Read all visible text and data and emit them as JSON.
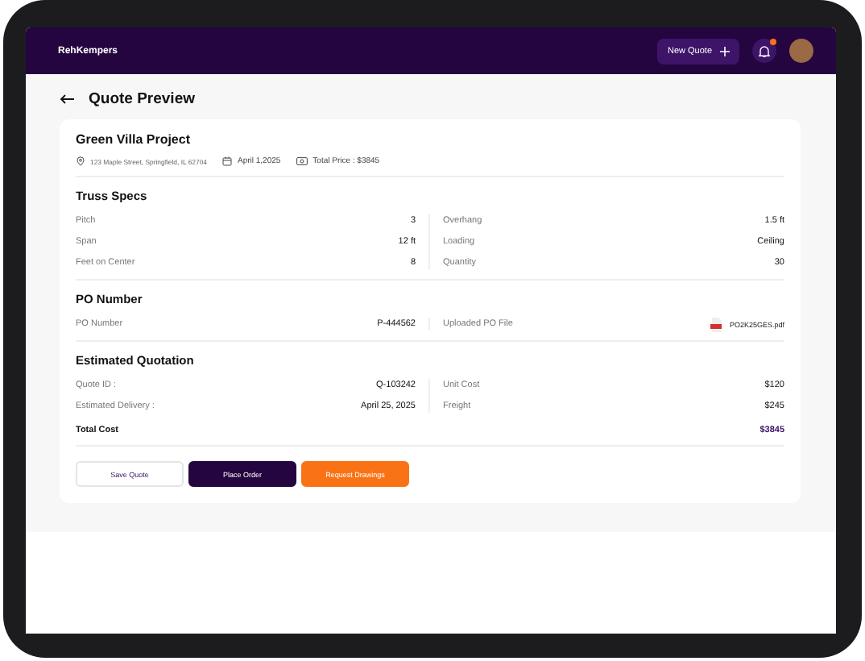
{
  "header": {
    "brand": "RehKempers",
    "new_quote_button": "New Quote",
    "has_notification": true
  },
  "page_title": "Quote Preview",
  "project": {
    "name": "Green Villa Project",
    "address": "123 Maple Street, Springfield, IL 62704",
    "date": "April 1,2025",
    "total_price": "Total Price : $3845"
  },
  "sections": [
    {
      "title": "Truss Specs",
      "left": [
        {
          "label": "Pitch",
          "value": "3",
          "kind": "text"
        },
        {
          "label": "Span",
          "value": "12 ft",
          "kind": "text"
        },
        {
          "label": "Feet on Center",
          "value": "8",
          "kind": "text"
        }
      ],
      "right": [
        {
          "label": "Overhang",
          "value": "1.5 ft",
          "kind": "text"
        },
        {
          "label": "Loading",
          "value": "Ceiling",
          "kind": "text"
        },
        {
          "label": "Quantity",
          "value": "30",
          "kind": "text"
        }
      ]
    },
    {
      "title": "PO Number",
      "left": [
        {
          "label": "PO Number",
          "value": "P-444562",
          "kind": "text"
        }
      ],
      "right": [
        {
          "label": "Uploaded PO File",
          "value": "PO2K25GES.pdf",
          "kind": "file"
        }
      ]
    },
    {
      "title": "Estimated Quotation",
      "left": [
        {
          "label": "Quote ID :",
          "value": "Q-103242",
          "kind": "text"
        },
        {
          "label": "Estimated Delivery :",
          "value": "April 25, 2025",
          "kind": "text"
        }
      ],
      "right": [
        {
          "label": "Unit Cost",
          "value": "$120",
          "kind": "text"
        },
        {
          "label": "Freight",
          "value": "$245",
          "kind": "text"
        }
      ],
      "total": {
        "label": "Total Cost",
        "value": "$3845"
      }
    }
  ],
  "buttons": [
    {
      "label": "Save Quote",
      "kind": "outline"
    },
    {
      "label": "Place Order",
      "kind": "primary"
    },
    {
      "label": "Request Drawings",
      "kind": "accent"
    }
  ]
}
